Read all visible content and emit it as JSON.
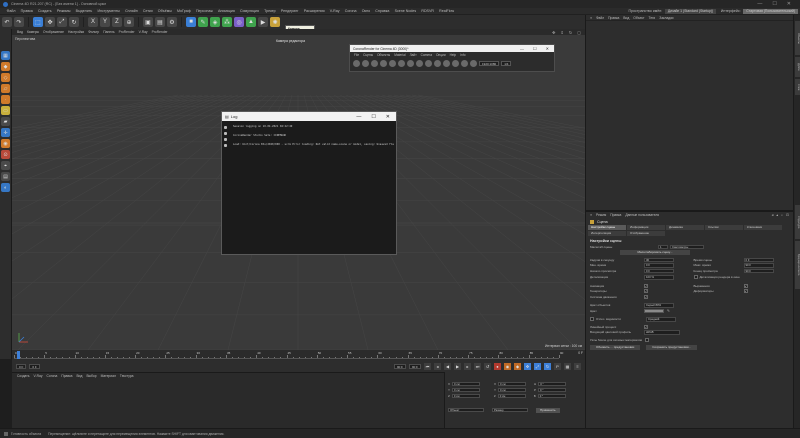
{
  "window": {
    "title": "Cinema 4D R21.207 (RC) - [Без имени 1] - Основной цикл",
    "controls": [
      "—",
      "☐",
      "✕"
    ]
  },
  "menubar": {
    "items": [
      "Файл",
      "Правка",
      "Создать",
      "Режимы",
      "Выделить",
      "Инструменты",
      "Сплайн",
      "Сетки",
      "Объёмы",
      "МоГраф",
      "Персонаж",
      "Анимация",
      "Симуляция",
      "Трекер",
      "Рендеринг",
      "Расширения",
      "V-Ray",
      "Corona",
      "Окно",
      "Справка",
      "Scene Nodes",
      "RDSVR",
      "RealFlow"
    ],
    "interface_label": "Пространство имён:",
    "layout_value": "Дизайн 1 (Standard (Startup))",
    "layout_label2": "Интерфейс:",
    "layout_value2": "Стартовая (Пользовательский)"
  },
  "toolbar": {
    "tooltip_title": "Камера",
    "tooltip_text": "Создать Камеру"
  },
  "viewport": {
    "menu": [
      "Вид",
      "Камеры",
      "Отображение",
      "Настройки",
      "Фильтр",
      "Панель",
      "ProRender",
      "V-Ray",
      "ProRender"
    ],
    "label": "Перспектива",
    "camera_label": "Камера редактора",
    "grid_scale": "Интервал сетки : 100 см"
  },
  "corona": {
    "title": "CoronaRender for Cinema 4D (3000)*",
    "menu": [
      "File",
      "Сцены",
      "Объекты",
      "Material",
      "Лайт",
      "Camera",
      "Опции",
      "Help",
      "Info"
    ],
    "controls": [
      "—",
      "☐",
      "✕"
    ],
    "field1": "1920:1080",
    "field2": "1/4"
  },
  "log": {
    "title": "Log",
    "controls": [
      "—",
      "☐",
      "✕"
    ],
    "lines": [
      "Session logging on 10.04.2021 04:22:49",
      "",
      "CoronaRender Studio Sets: CINEMA4D",
      "",
      "Load: Uint/Corona Edu/2020/000 - scrm Error loading: Not valid name-scene or model, saving: Unsaved flag set"
    ]
  },
  "timeline": {
    "labels": [
      "0",
      "5",
      "10",
      "15",
      "20",
      "25",
      "30",
      "35",
      "40",
      "45",
      "50",
      "55",
      "60",
      "65",
      "70",
      "75",
      "80",
      "85",
      "90"
    ],
    "frame_end": "0 F"
  },
  "transport": {
    "start": "0 F",
    "current": "0 F",
    "end": "90 F",
    "max": "90 F"
  },
  "material_manager": {
    "menu": [
      "Создать",
      "V-Ray",
      "Corona",
      "Правка",
      "Вид",
      "Выбор",
      "Материал",
      "Текстура"
    ]
  },
  "coordinates": {
    "rows": [
      {
        "a": "X",
        "av": "0 см",
        "b": "X",
        "bv": "0 см",
        "c": "H",
        "cv": "0 °"
      },
      {
        "a": "Y",
        "av": "0 см",
        "b": "Y",
        "bv": "0 см",
        "c": "P",
        "cv": "0 °"
      },
      {
        "a": "Z",
        "av": "0 см",
        "b": "Z",
        "bv": "0 см",
        "c": "B",
        "cv": "0 °"
      }
    ],
    "mode1": "Объект",
    "mode2": "Размер",
    "apply": "Применить"
  },
  "object_manager": {
    "menu": [
      "Файл",
      "Правка",
      "Вид",
      "Объект",
      "Теги",
      "Закладки"
    ]
  },
  "right_tabs": [
    "Объекты",
    "Дубли",
    "Слои",
    "Структура",
    "Браузер контента"
  ],
  "attribute_manager": {
    "menu": [
      "Режим",
      "Правка",
      "Данные пользователя"
    ],
    "object": "Сцена",
    "tabs": [
      "Настройки сцены",
      "Информация",
      "Динамика",
      "Ссылки",
      "Ключевики",
      "Интерполяция",
      "Отображение"
    ],
    "section": "Настройки сцены",
    "project_scale_label": "Масштаб сцены",
    "project_scale_value": "1",
    "project_scale_unit": "Сантиметры",
    "scale_button": "Масштабировать сцену...",
    "fields_left": [
      {
        "label": "Кадров в секунду",
        "value": "30"
      },
      {
        "label": "Мин. время",
        "value": "0 F"
      },
      {
        "label": "Начало просмотра",
        "value": "0 F"
      }
    ],
    "fields_right": [
      {
        "label": "Время сцены",
        "value": "0 F"
      },
      {
        "label": "Макс. время",
        "value": "90 F"
      },
      {
        "label": "Конец просмотра",
        "value": "90 F"
      }
    ],
    "lod_label": "Детализация",
    "lod_value": "100 %",
    "lod_render_label": "Детализация рендера в окне",
    "checks_left": [
      {
        "label": "Анимация",
        "checked": "✓"
      },
      {
        "label": "Генераторы",
        "checked": "✓"
      },
      {
        "label": "Система движения",
        "checked": "✓"
      }
    ],
    "checks_right": [
      {
        "label": "Выражения",
        "checked": "✓"
      },
      {
        "label": "Деформаторы",
        "checked": "✓"
      }
    ],
    "color_obj_label": "Цвет объектов",
    "color_obj_value": "Серый 80%",
    "color_label": "Цвет",
    "clip_label": "Отсеч. видимости",
    "clip_value": "Средний",
    "linear_label": "Линейный процесс",
    "linear_checked": "✓",
    "input_color_label": "Входящий цветовой профиль",
    "input_color_value": "sRGB",
    "node_label": "Узлы Scene для сетевых материалов",
    "button1": "Обновить ... предустановки",
    "button2": "Сохранить предустановки..."
  },
  "statusbar": {
    "text": "Перемещение: щёлкните и перетащите для перемещения элементов. Нажмите SHIFT для квантования движения.",
    "label": "Готовность объекта"
  }
}
